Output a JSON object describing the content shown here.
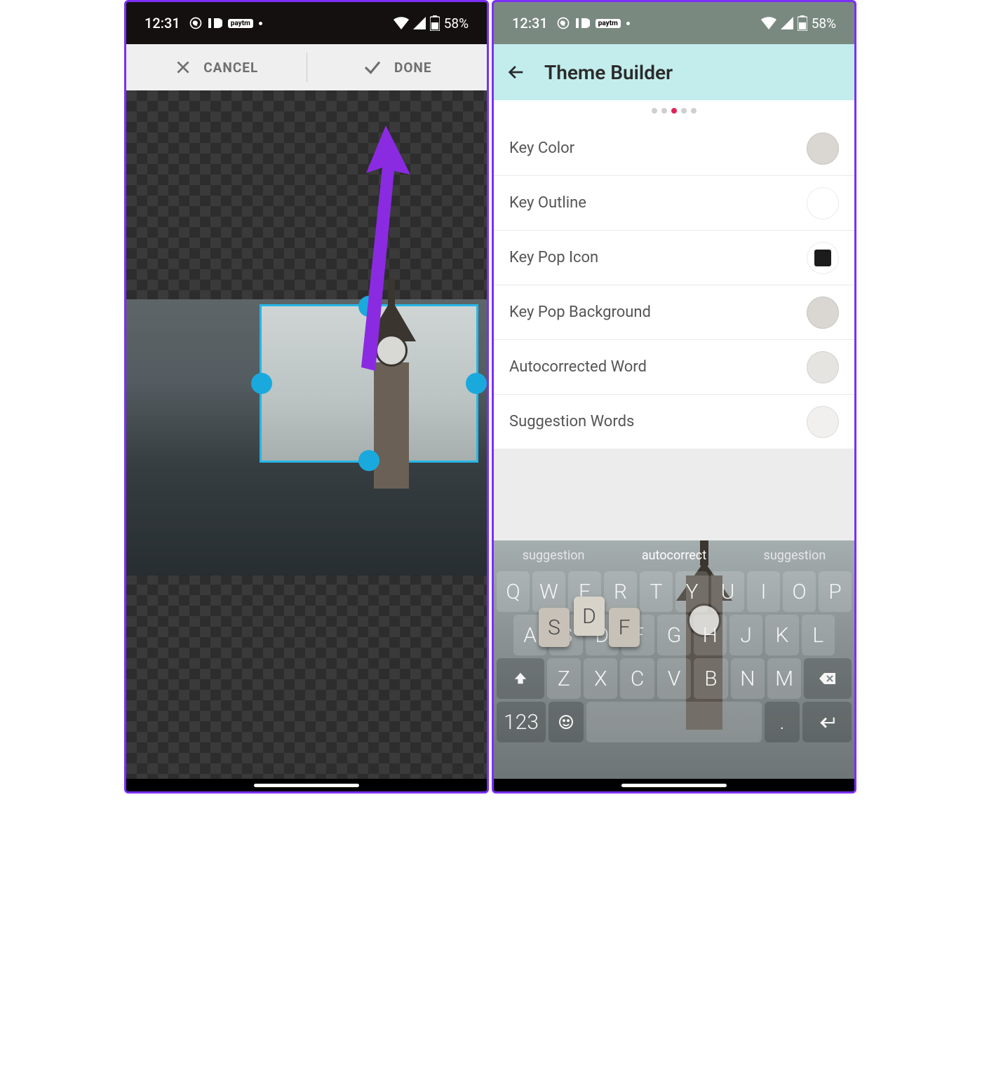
{
  "status": {
    "time": "12:31",
    "battery": "58%"
  },
  "left": {
    "toolbar": {
      "cancel": "CANCEL",
      "done": "DONE"
    }
  },
  "right": {
    "header": {
      "title": "Theme Builder"
    },
    "pager": {
      "active_index": 2,
      "count": 5
    },
    "items": [
      {
        "label": "Key Color",
        "swatch": "swatch"
      },
      {
        "label": "Key Outline",
        "swatch": "swatch white"
      },
      {
        "label": "Key Pop Icon",
        "swatch": "swatch white",
        "innerSquare": true
      },
      {
        "label": "Key Pop Background",
        "swatch": "swatch"
      },
      {
        "label": "Autocorrected Word",
        "swatch": "swatch lgrey"
      },
      {
        "label": "Suggestion Words",
        "swatch": "swatch vlgrey"
      }
    ],
    "keyboard": {
      "suggestions": [
        "suggestion",
        "autocorrect",
        "suggestion"
      ],
      "row1": [
        "Q",
        "W",
        "E",
        "R",
        "T",
        "Y",
        "U",
        "I",
        "O",
        "P"
      ],
      "row2": [
        "A",
        "S",
        "D",
        "F",
        "G",
        "H",
        "J",
        "K",
        "L"
      ],
      "row3": [
        "Z",
        "X",
        "C",
        "V",
        "B",
        "N",
        "M"
      ],
      "popups": [
        "S",
        "D",
        "F"
      ],
      "numeric_label": "123"
    }
  }
}
